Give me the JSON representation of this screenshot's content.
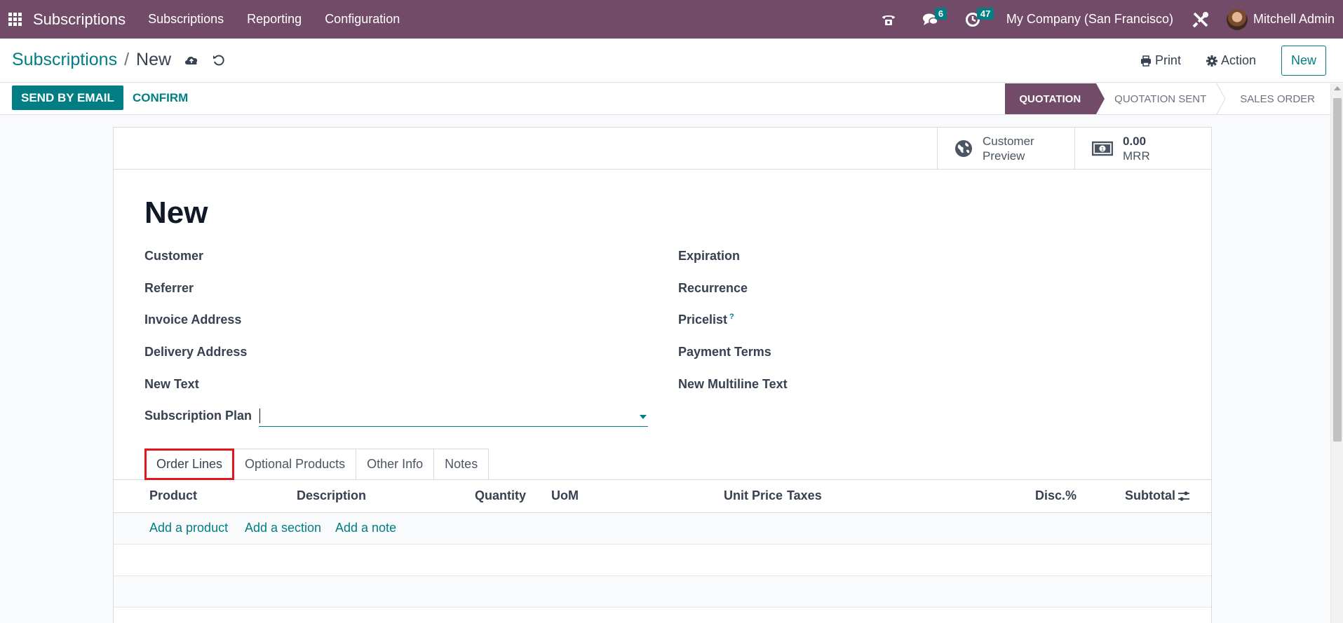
{
  "navbar": {
    "app_name": "Subscriptions",
    "menus": [
      "Subscriptions",
      "Reporting",
      "Configuration"
    ],
    "messages_count": "6",
    "activities_count": "47",
    "company": "My Company (San Francisco)",
    "user": "Mitchell Admin",
    "bg_color": "#714b67"
  },
  "control_panel": {
    "breadcrumb_parent": "Subscriptions",
    "breadcrumb_separator": "/",
    "breadcrumb_current": "New",
    "print_label": "Print",
    "action_label": "Action",
    "new_label": "New"
  },
  "statusbar": {
    "send_email_label": "SEND BY EMAIL",
    "confirm_label": "CONFIRM",
    "stages": [
      "QUOTATION",
      "QUOTATION SENT",
      "SALES ORDER"
    ],
    "active_stage": "QUOTATION"
  },
  "smart_buttons": {
    "customer_preview_line1": "Customer",
    "customer_preview_line2": "Preview",
    "mrr_value": "0.00",
    "mrr_label": "MRR"
  },
  "form": {
    "title": "New",
    "left_fields": [
      "Customer",
      "Referrer",
      "Invoice Address",
      "Delivery Address",
      "New Text",
      "Subscription Plan"
    ],
    "right_fields": [
      "Expiration",
      "Recurrence",
      "Pricelist",
      "Payment Terms",
      "New Multiline Text"
    ],
    "pricelist_help": "?",
    "subscription_plan_value": ""
  },
  "tabs": [
    "Order Lines",
    "Optional Products",
    "Other Info",
    "Notes"
  ],
  "active_tab": "Order Lines",
  "order_lines": {
    "columns": [
      "Product",
      "Description",
      "Quantity",
      "UoM",
      "Unit Price",
      "Taxes",
      "Disc.%",
      "Subtotal"
    ],
    "add_links": [
      "Add a product",
      "Add a section",
      "Add a note"
    ]
  },
  "colors": {
    "accent": "#017e84",
    "brand": "#714b67",
    "highlight_box": "#e0161e"
  }
}
